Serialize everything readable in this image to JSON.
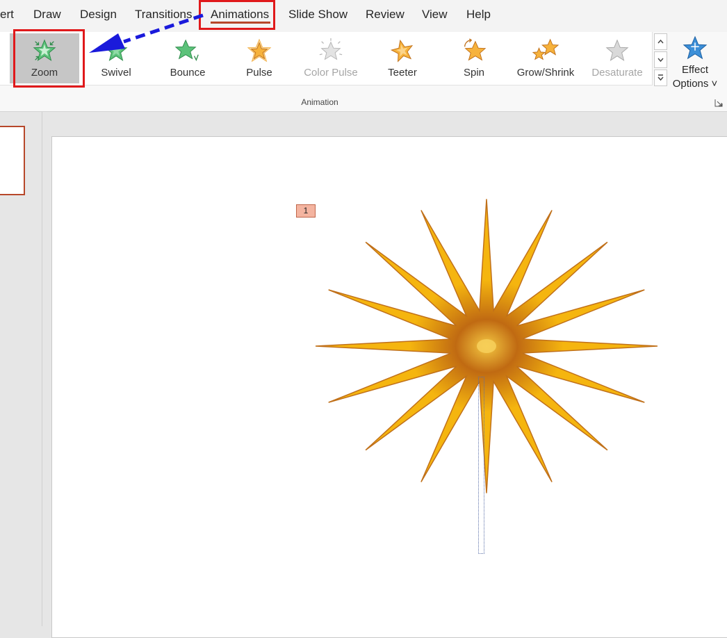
{
  "tabs": [
    "ert",
    "Draw",
    "Design",
    "Transitions",
    "Animations",
    "Slide Show",
    "Review",
    "View",
    "Help"
  ],
  "active_tab": "Animations",
  "gallery": [
    {
      "label": "Zoom",
      "icon": "zoom-star-icon",
      "selected": true,
      "disabled": false
    },
    {
      "label": "Swivel",
      "icon": "swivel-star-icon",
      "selected": false,
      "disabled": false
    },
    {
      "label": "Bounce",
      "icon": "bounce-star-icon",
      "selected": false,
      "disabled": false
    },
    {
      "label": "Pulse",
      "icon": "pulse-star-icon",
      "selected": false,
      "disabled": false
    },
    {
      "label": "Color Pulse",
      "icon": "color-pulse-star-icon",
      "selected": false,
      "disabled": true
    },
    {
      "label": "Teeter",
      "icon": "teeter-star-icon",
      "selected": false,
      "disabled": false
    },
    {
      "label": "Spin",
      "icon": "spin-star-icon",
      "selected": false,
      "disabled": false
    },
    {
      "label": "Grow/Shrink",
      "icon": "grow-shrink-star-icon",
      "selected": false,
      "disabled": false
    },
    {
      "label": "Desaturate",
      "icon": "desaturate-star-icon",
      "selected": false,
      "disabled": true
    }
  ],
  "effect_options": {
    "line1": "Effect",
    "line2": "Options ˅"
  },
  "group_label": "Animation",
  "animation_tag": "1",
  "colors": {
    "accent": "#b7472a",
    "highlight_box": "#e0191b",
    "arrow": "#1a1adb",
    "burst_fill": "#f5b50f",
    "burst_edge": "#c0701a",
    "entrance_green": "#5cc27a",
    "emphasis_orange": "#f6b23c"
  }
}
